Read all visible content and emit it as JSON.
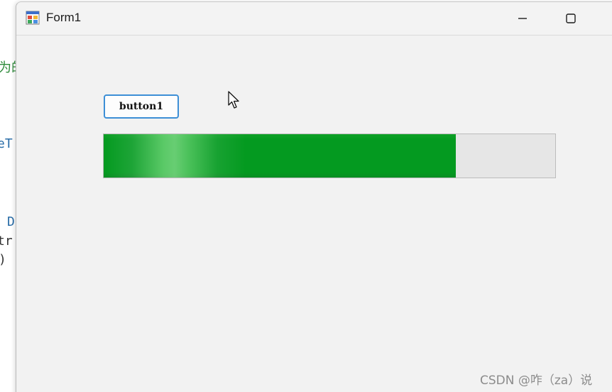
{
  "background_code": {
    "line1": "为的",
    "line2": "eT",
    "line3": "D",
    "line4": "tr",
    "line5": ")"
  },
  "window": {
    "title": "Form1",
    "icon": "winforms-app-icon",
    "controls": {
      "minimize_icon": "minimize-icon",
      "maximize_icon": "maximize-icon"
    }
  },
  "form": {
    "button1_label": "button1",
    "progress_bar": {
      "value_percent": 78,
      "fill_color": "#049a20",
      "track_color": "#e6e6e6"
    }
  },
  "cursor_icon": "mouse-pointer-icon",
  "watermark": "CSDN @咋（za）说",
  "colors": {
    "button_border": "#3d8fd6",
    "window_bg": "#f2f2f2"
  }
}
